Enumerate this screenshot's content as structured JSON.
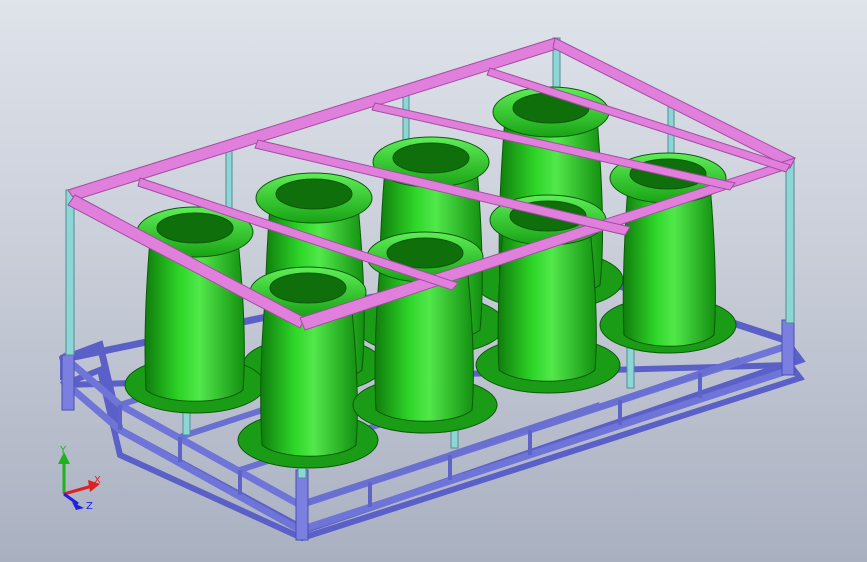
{
  "viewport": {
    "background": "#c9ced9",
    "model": {
      "rack_color": "#7b7fe0",
      "post_color": "#8ed6d6",
      "top_frame_color": "#e07fdc",
      "part_color": "#23c21d",
      "part_count": 8
    }
  },
  "triad": {
    "x_label": "X",
    "y_label": "Y",
    "z_label": "Z",
    "x_color": "#e02020",
    "y_color": "#20b020",
    "z_color": "#2020e0"
  }
}
